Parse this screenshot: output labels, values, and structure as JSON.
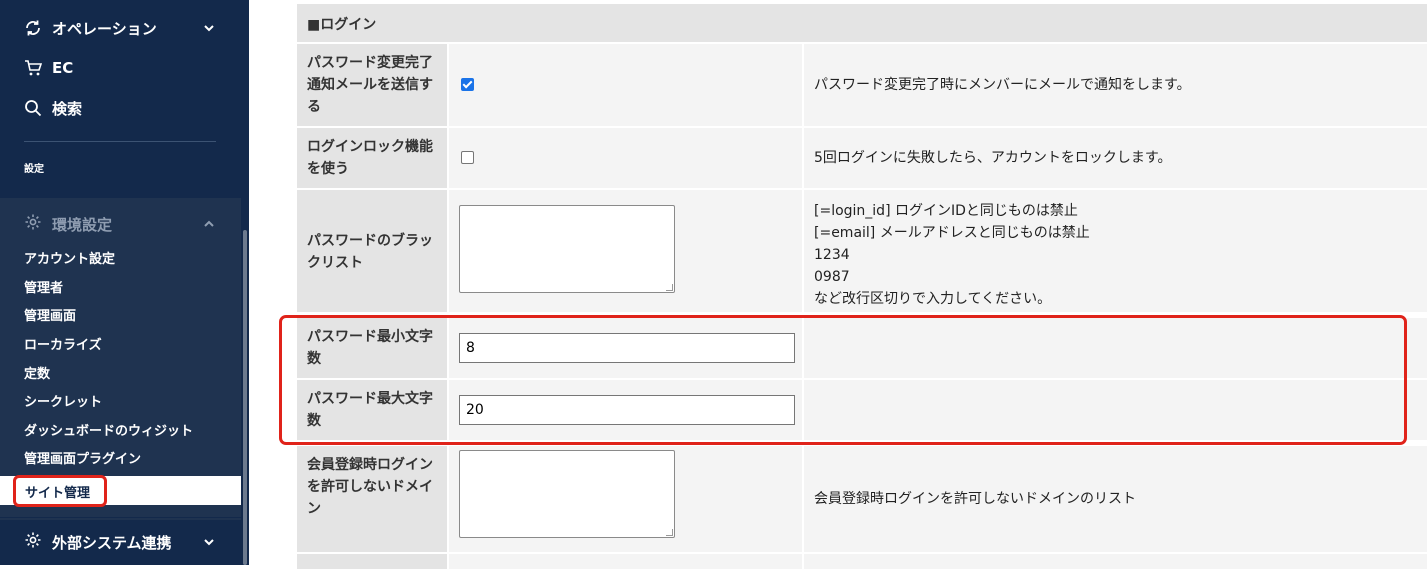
{
  "sidebar": {
    "nav": [
      {
        "label": "オペレーション",
        "icon": "refresh-icon"
      },
      {
        "label": "EC",
        "icon": "cart-icon"
      },
      {
        "label": "検索",
        "icon": "search-icon"
      }
    ],
    "section_label": "設定",
    "group": {
      "label": "環境設定",
      "items": [
        "アカウント設定",
        "管理者",
        "管理画面",
        "ローカライズ",
        "定数",
        "シークレット",
        "ダッシュボードのウィジット",
        "管理画面プラグイン"
      ],
      "active_item": "サイト管理"
    },
    "bottom_item": {
      "label": "外部システム連携"
    }
  },
  "table": {
    "section_title": "■ログイン",
    "rows": [
      {
        "label": "パスワード変更完了通知メールを送信する",
        "control": "checkbox",
        "checked": true,
        "desc": "パスワード変更完了時にメンバーにメールで通知をします。"
      },
      {
        "label": "ログインロック機能を使う",
        "control": "checkbox",
        "checked": false,
        "desc": "5回ログインに失敗したら、アカウントをロックします。"
      },
      {
        "label": "パスワードのブラックリスト",
        "control": "textarea",
        "desc_lines": [
          "[=login_id] ログインIDと同じものは禁止",
          "[=email] メールアドレスと同じものは禁止",
          "1234",
          "0987",
          "など改行区切りで入力してください。"
        ]
      },
      {
        "label": "パスワード最小文字数",
        "control": "text",
        "value": "8",
        "desc": ""
      },
      {
        "label": "パスワード最大文字数",
        "control": "text",
        "value": "20",
        "desc": ""
      },
      {
        "label": "会員登録時ログインを許可しないドメイン",
        "control": "textarea",
        "desc": "会員登録時ログインを許可しないドメインのリスト"
      }
    ]
  },
  "colors": {
    "sidebar_bg": "#13294b",
    "highlight": "#e0231a",
    "checkbox": "#1a73e8"
  }
}
